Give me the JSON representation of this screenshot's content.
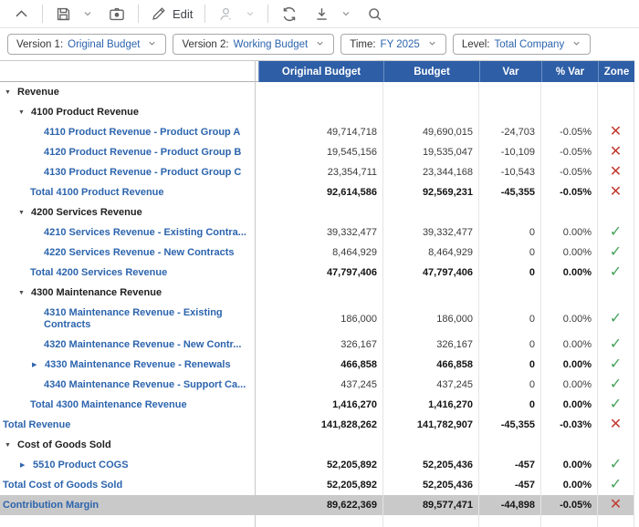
{
  "toolbar": {
    "edit_label": "Edit"
  },
  "filters": [
    {
      "label": "Version 1:",
      "value": "Original Budget"
    },
    {
      "label": "Version 2:",
      "value": "Working Budget"
    },
    {
      "label": "Time:",
      "value": "FY 2025"
    },
    {
      "label": "Level:",
      "value": "Total Company"
    }
  ],
  "icons": {
    "zone_fail": "✕",
    "zone_pass": "✓",
    "collapse": "▼",
    "expand": "▶",
    "toolbar": [
      "chevron-up",
      "save",
      "camera",
      "pencil-edit",
      "user",
      "refresh",
      "download",
      "search"
    ]
  },
  "colors": {
    "header_blue": "#2e5ea6",
    "link_blue": "#2c64ad",
    "fail_red": "#c23b31",
    "pass_green": "#46a25c",
    "highlight_grey": "#c9c9c9"
  },
  "table": {
    "columns": [
      "Original Budget",
      "Budget",
      "Var",
      "% Var",
      "Zone"
    ],
    "rows": [
      {
        "label": "Revenue",
        "marker": "down",
        "ob": "",
        "budget": "",
        "var": "",
        "pvar": "",
        "zone": ""
      },
      {
        "label": "4100 Product Revenue",
        "marker": "down",
        "ob": "",
        "budget": "",
        "var": "",
        "pvar": "",
        "zone": ""
      },
      {
        "label": "4110 Product Revenue - Product Group A",
        "marker": "",
        "ob": "49,714,718",
        "budget": "49,690,015",
        "var": "-24,703",
        "pvar": "-0.05%",
        "zone": "fail"
      },
      {
        "label": "4120 Product Revenue - Product Group B",
        "marker": "",
        "ob": "19,545,156",
        "budget": "19,535,047",
        "var": "-10,109",
        "pvar": "-0.05%",
        "zone": "fail"
      },
      {
        "label": "4130 Product Revenue - Product Group C",
        "marker": "",
        "ob": "23,354,711",
        "budget": "23,344,168",
        "var": "-10,543",
        "pvar": "-0.05%",
        "zone": "fail"
      },
      {
        "label": "Total 4100 Product Revenue",
        "marker": "",
        "ob": "92,614,586",
        "budget": "92,569,231",
        "var": "-45,355",
        "pvar": "-0.05%",
        "zone": "fail"
      },
      {
        "label": "4200 Services Revenue",
        "marker": "down",
        "ob": "",
        "budget": "",
        "var": "",
        "pvar": "",
        "zone": ""
      },
      {
        "label": "4210 Services Revenue - Existing Contra...",
        "marker": "",
        "ob": "39,332,477",
        "budget": "39,332,477",
        "var": "0",
        "pvar": "0.00%",
        "zone": "pass"
      },
      {
        "label": "4220 Services Revenue - New Contracts",
        "marker": "",
        "ob": "8,464,929",
        "budget": "8,464,929",
        "var": "0",
        "pvar": "0.00%",
        "zone": "pass"
      },
      {
        "label": "Total 4200 Services Revenue",
        "marker": "",
        "ob": "47,797,406",
        "budget": "47,797,406",
        "var": "0",
        "pvar": "0.00%",
        "zone": "pass"
      },
      {
        "label": "4300 Maintenance Revenue",
        "marker": "down",
        "ob": "",
        "budget": "",
        "var": "",
        "pvar": "",
        "zone": ""
      },
      {
        "label": "4310 Maintenance Revenue - Existing Contracts",
        "marker": "",
        "ob": "186,000",
        "budget": "186,000",
        "var": "0",
        "pvar": "0.00%",
        "zone": "pass"
      },
      {
        "label": "4320 Maintenance Revenue - New Contr...",
        "marker": "",
        "ob": "326,167",
        "budget": "326,167",
        "var": "0",
        "pvar": "0.00%",
        "zone": "pass"
      },
      {
        "label": "4330 Maintenance Revenue - Renewals",
        "marker": "right",
        "ob": "466,858",
        "budget": "466,858",
        "var": "0",
        "pvar": "0.00%",
        "zone": "pass"
      },
      {
        "label": "4340 Maintenance Revenue - Support Ca...",
        "marker": "",
        "ob": "437,245",
        "budget": "437,245",
        "var": "0",
        "pvar": "0.00%",
        "zone": "pass"
      },
      {
        "label": "Total 4300 Maintenance Revenue",
        "marker": "",
        "ob": "1,416,270",
        "budget": "1,416,270",
        "var": "0",
        "pvar": "0.00%",
        "zone": "pass"
      },
      {
        "label": "Total Revenue",
        "marker": "",
        "ob": "141,828,262",
        "budget": "141,782,907",
        "var": "-45,355",
        "pvar": "-0.03%",
        "zone": "fail"
      },
      {
        "label": "Cost of Goods Sold",
        "marker": "down",
        "ob": "",
        "budget": "",
        "var": "",
        "pvar": "",
        "zone": ""
      },
      {
        "label": "5510 Product COGS",
        "marker": "right",
        "ob": "52,205,892",
        "budget": "52,205,436",
        "var": "-457",
        "pvar": "0.00%",
        "zone": "pass"
      },
      {
        "label": "Total Cost of Goods Sold",
        "marker": "",
        "ob": "52,205,892",
        "budget": "52,205,436",
        "var": "-457",
        "pvar": "0.00%",
        "zone": "pass"
      },
      {
        "label": "Contribution Margin",
        "marker": "",
        "ob": "89,622,369",
        "budget": "89,577,471",
        "var": "-44,898",
        "pvar": "-0.05%",
        "zone": "fail"
      }
    ]
  }
}
